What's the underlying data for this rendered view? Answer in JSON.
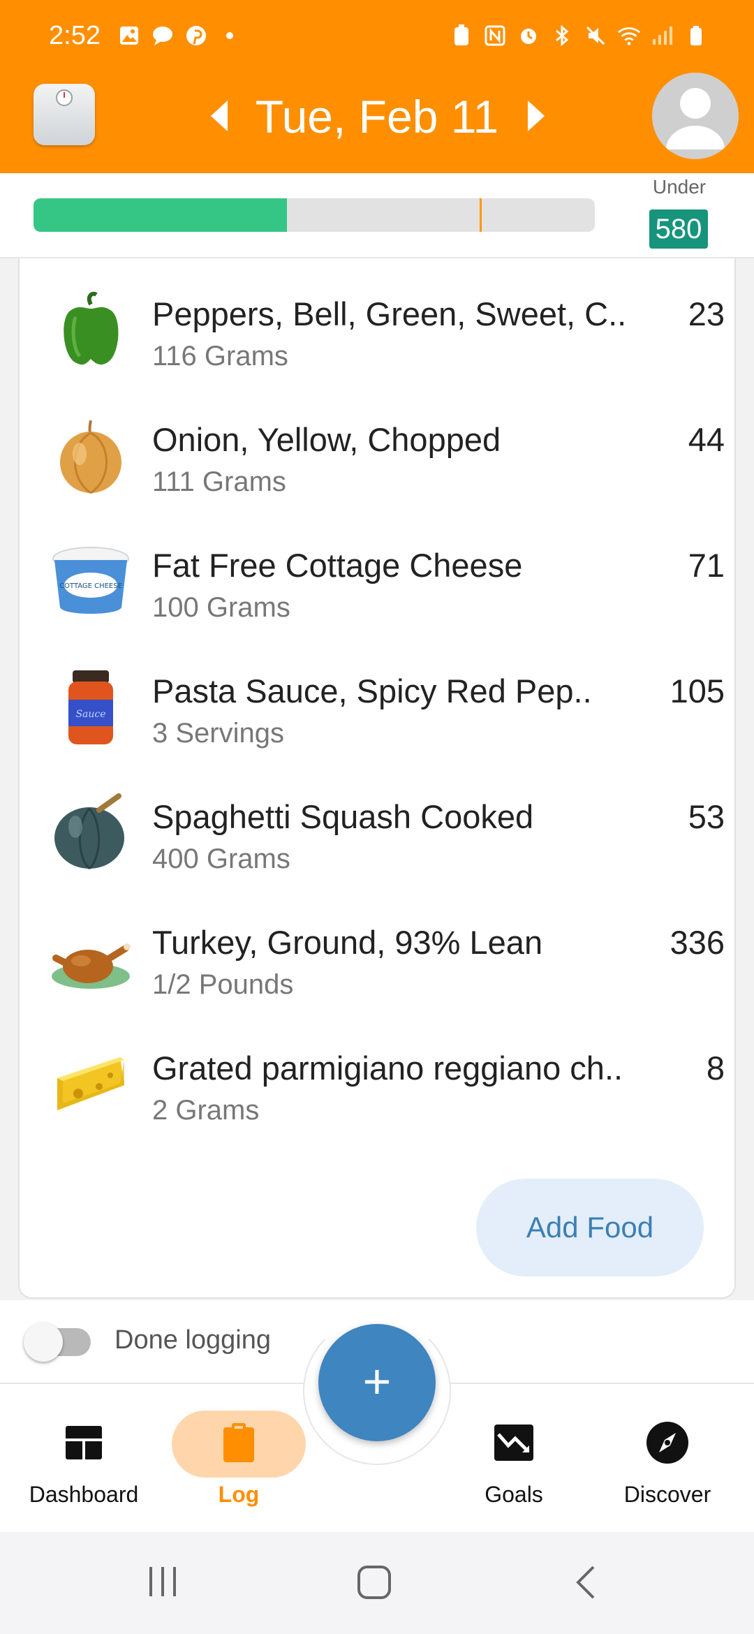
{
  "status_bar": {
    "time": "2:52"
  },
  "header": {
    "date": "Tue, Feb 11"
  },
  "budget": {
    "progress_fraction": 0.452,
    "marker_fraction": 0.795,
    "under_label": "Under",
    "under_value": "580",
    "colors": {
      "fill": "#35c685",
      "marker": "#ff9800",
      "badge": "#17947c"
    }
  },
  "foods": [
    {
      "name": "Peppers, Bell, Green, Sweet, C..",
      "quantity": "116 Grams",
      "calories": "23",
      "icon": "green-pepper-icon"
    },
    {
      "name": "Onion, Yellow, Chopped",
      "quantity": "111 Grams",
      "calories": "44",
      "icon": "onion-icon"
    },
    {
      "name": "Fat Free Cottage Cheese",
      "quantity": "100 Grams",
      "calories": "71",
      "icon": "cottage-cheese-icon",
      "icon_text": "COTTAGE CHEESE"
    },
    {
      "name": "Pasta Sauce, Spicy Red Pep..",
      "quantity": "3 Servings",
      "calories": "105",
      "icon": "sauce-jar-icon",
      "icon_text": "Sauce"
    },
    {
      "name": "Spaghetti Squash Cooked",
      "quantity": "400 Grams",
      "calories": "53",
      "icon": "squash-icon"
    },
    {
      "name": "Turkey, Ground, 93% Lean",
      "quantity": "1/2 Pounds",
      "calories": "336",
      "icon": "roast-turkey-icon"
    },
    {
      "name": "Grated parmigiano reggiano ch..",
      "quantity": "2 Grams",
      "calories": "8",
      "icon": "cheese-wedge-icon"
    }
  ],
  "add_food_label": "Add Food",
  "done_logging": {
    "label": "Done logging",
    "enabled": false
  },
  "fab_label": "+",
  "nav": {
    "dashboard": "Dashboard",
    "log": "Log",
    "goals": "Goals",
    "discover": "Discover",
    "accent": "#ff8f00"
  },
  "theme": {
    "header": "#ff8f00",
    "fab": "#3f85c0"
  }
}
